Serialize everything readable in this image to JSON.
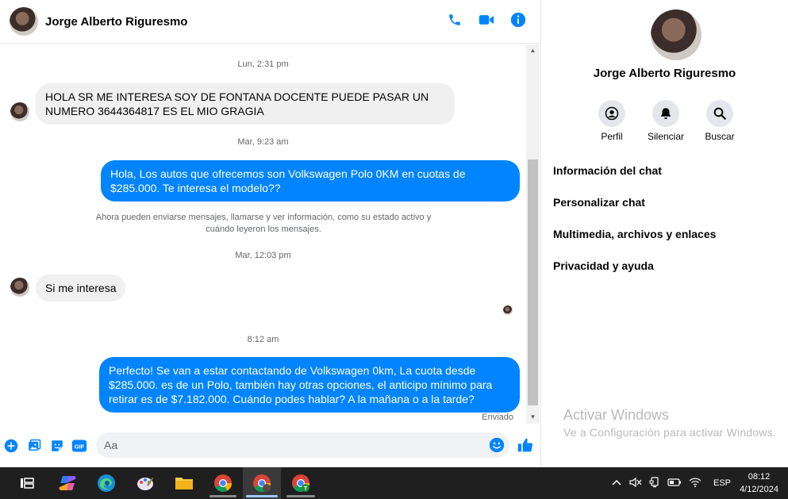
{
  "header": {
    "contact_name": "Jorge Alberto Riguresmo",
    "actions": [
      "phone-icon",
      "video-icon",
      "info-icon"
    ],
    "accent_color": "#0084ff"
  },
  "messages": [
    {
      "type": "timestamp",
      "text": "Lun, 2:31 pm"
    },
    {
      "type": "incoming",
      "text": "HOLA SR ME INTERESA SOY DE FONTANA DOCENTE PUEDE PASAR UN NUMERO 3644364817 ES EL MIO GRAGIA"
    },
    {
      "type": "timestamp",
      "text": "Mar, 9:23 am"
    },
    {
      "type": "outgoing",
      "text": "Hola, Los autos que ofrecemos son Volkswagen Polo 0KM en cuotas de $285.000. Te interesa el modelo??"
    },
    {
      "type": "notice",
      "text": "Ahora pueden enviarse mensajes, llamarse y ver información, como su estado activo y cuándo leyeron los mensajes."
    },
    {
      "type": "timestamp",
      "text": "Mar, 12:03 pm"
    },
    {
      "type": "incoming",
      "text": "Si me interesa"
    },
    {
      "type": "timestamp",
      "text": "8:12 am"
    },
    {
      "type": "outgoing",
      "text": "Perfecto!  Se van a estar contactando de Volkswagen 0km, La cuota desde $285.000. es de un Polo, también hay otras opciones, el anticipo mínimo para retirar es de $7.182.000. Cuándo podes hablar? A la mañana o a la tarde?"
    }
  ],
  "sent_status": "Enviado",
  "composer": {
    "placeholder": "Aa",
    "tools": [
      "add-icon",
      "photo-icon",
      "sticker-icon",
      "gif-icon"
    ],
    "gif_label": "GIF",
    "right_tools": [
      "emoji-icon",
      "like-icon"
    ]
  },
  "info_panel": {
    "name": "Jorge Alberto Riguresmo",
    "actions": [
      {
        "label": "Perfil",
        "icon": "profile-icon"
      },
      {
        "label": "Silenciar",
        "icon": "bell-icon"
      },
      {
        "label": "Buscar",
        "icon": "search-icon"
      }
    ],
    "menu": [
      "Información del chat",
      "Personalizar chat",
      "Multimedia, archivos y enlaces",
      "Privacidad y ayuda"
    ]
  },
  "watermark": {
    "title": "Activar Windows",
    "subtitle": "Ve a Configuración para activar Windows."
  },
  "taskbar": {
    "apps": [
      "task-view-icon",
      "copilot-icon",
      "edge-icon",
      "paint-icon",
      "file-explorer-icon",
      "chrome-icon",
      "chrome-profile-icon",
      "chrome-t-icon"
    ],
    "language": "ESP",
    "time": "08:12",
    "date": "4/12/2024"
  }
}
